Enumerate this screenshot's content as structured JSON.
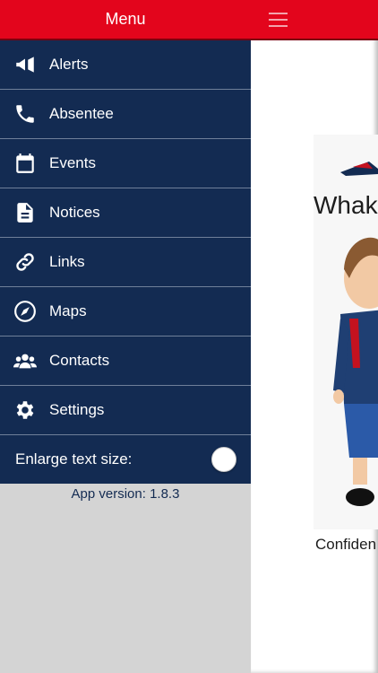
{
  "drawer": {
    "title": "Menu",
    "items": [
      {
        "label": "Alerts",
        "icon": "megaphone-icon"
      },
      {
        "label": "Absentee",
        "icon": "phone-icon"
      },
      {
        "label": "Events",
        "icon": "calendar-icon"
      },
      {
        "label": "Notices",
        "icon": "document-icon"
      },
      {
        "label": "Links",
        "icon": "link-icon"
      },
      {
        "label": "Maps",
        "icon": "compass-icon"
      },
      {
        "label": "Contacts",
        "icon": "contacts-icon"
      },
      {
        "label": "Settings",
        "icon": "gear-icon"
      }
    ],
    "enlarge_text_label": "Enlarge text size:",
    "enlarge_text_on": false,
    "app_version": "App version: 1.8.3"
  },
  "content": {
    "poster_title_partial": "Whak",
    "poster_caption_partial": "Confiden"
  },
  "colors": {
    "header_red": "#e3051c",
    "menu_navy": "#132b52",
    "drawer_gray": "#d4d4d4"
  }
}
